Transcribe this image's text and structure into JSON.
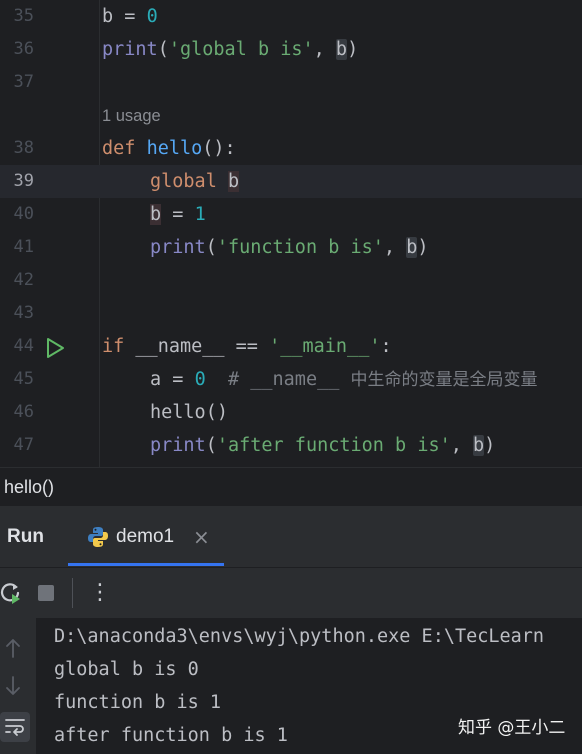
{
  "editor": {
    "line_numbers": [
      "35",
      "36",
      "37",
      "38",
      "39",
      "40",
      "41",
      "42",
      "43",
      "44",
      "45",
      "46",
      "47"
    ],
    "usage_hint": "1 usage",
    "l35": {
      "var": "b",
      "op": " = ",
      "num": "0"
    },
    "l36": {
      "func": "print",
      "open": "(",
      "str": "'global b is'",
      "comma": ", ",
      "arg": "b",
      "close": ")"
    },
    "l38": {
      "kw": "def",
      "name": "hello",
      "rest": "():"
    },
    "l39": {
      "kw": "global",
      "var": "b"
    },
    "l40": {
      "var": "b",
      "op": " = ",
      "num": "1"
    },
    "l41": {
      "func": "print",
      "open": "(",
      "str": "'function b is'",
      "comma": ", ",
      "arg": "b",
      "close": ")"
    },
    "l44": {
      "kw": "if",
      "dunder": "__name__",
      "op": " == ",
      "str": "'__main__'",
      "colon": ":"
    },
    "l45": {
      "var": "a",
      "op": " = ",
      "num": "0",
      "comment": "  # __name__ ",
      "comment_cn": "中生命的变量是全局变量"
    },
    "l46": {
      "call": "hello()"
    },
    "l47": {
      "func": "print",
      "open": "(",
      "str": "'after function b is'",
      "comma": ", ",
      "arg": "b",
      "close": ")"
    }
  },
  "breadcrumb": {
    "text": "hello()"
  },
  "run_panel": {
    "title": "Run",
    "tab_label": "demo1",
    "tab_close": "×"
  },
  "toolbar": {
    "more": "⋮"
  },
  "console": {
    "lines": [
      "D:\\anaconda3\\envs\\wyj\\python.exe E:\\TecLearn",
      "global b is 0",
      "function b is 1",
      "after function b is 1"
    ]
  },
  "watermark": {
    "text": "知乎 @王小二"
  },
  "colors": {
    "background": "#1e1f22",
    "panel": "#2b2d30",
    "keyword": "#cf8e6d",
    "function": "#56a8f5",
    "builtin": "#8888c6",
    "number": "#2aacb8",
    "string": "#6aab73",
    "comment": "#7a7e85",
    "dunder": "#b200b2",
    "run_green": "#5fb865",
    "tab_accent": "#3574f0"
  },
  "icons": [
    "run-gutter-icon",
    "python-icon",
    "rerun-icon",
    "stop-icon",
    "more-icon",
    "scroll-up-icon",
    "scroll-down-icon",
    "soft-wrap-icon"
  ]
}
